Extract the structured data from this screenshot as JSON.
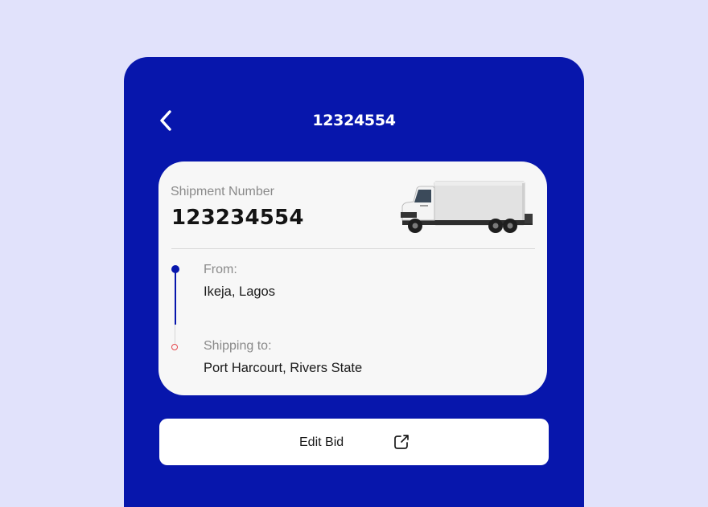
{
  "header": {
    "title": "12324554",
    "back_icon": "chevron-left-icon"
  },
  "shipment": {
    "number_label": "Shipment Number",
    "number": "123234554",
    "vehicle_icon": "box-truck-image"
  },
  "route": {
    "from_label": "From:",
    "from_value": "Ikeja, Lagos",
    "to_label": "Shipping to:",
    "to_value": "Port Harcourt, Rivers State"
  },
  "actions": {
    "edit_bid_label": "Edit Bid",
    "edit_bid_icon": "external-link-icon"
  },
  "colors": {
    "background": "#E1E2FB",
    "primary": "#0716AC",
    "card": "#F7F7F7",
    "destination_dot": "#E5484D"
  }
}
